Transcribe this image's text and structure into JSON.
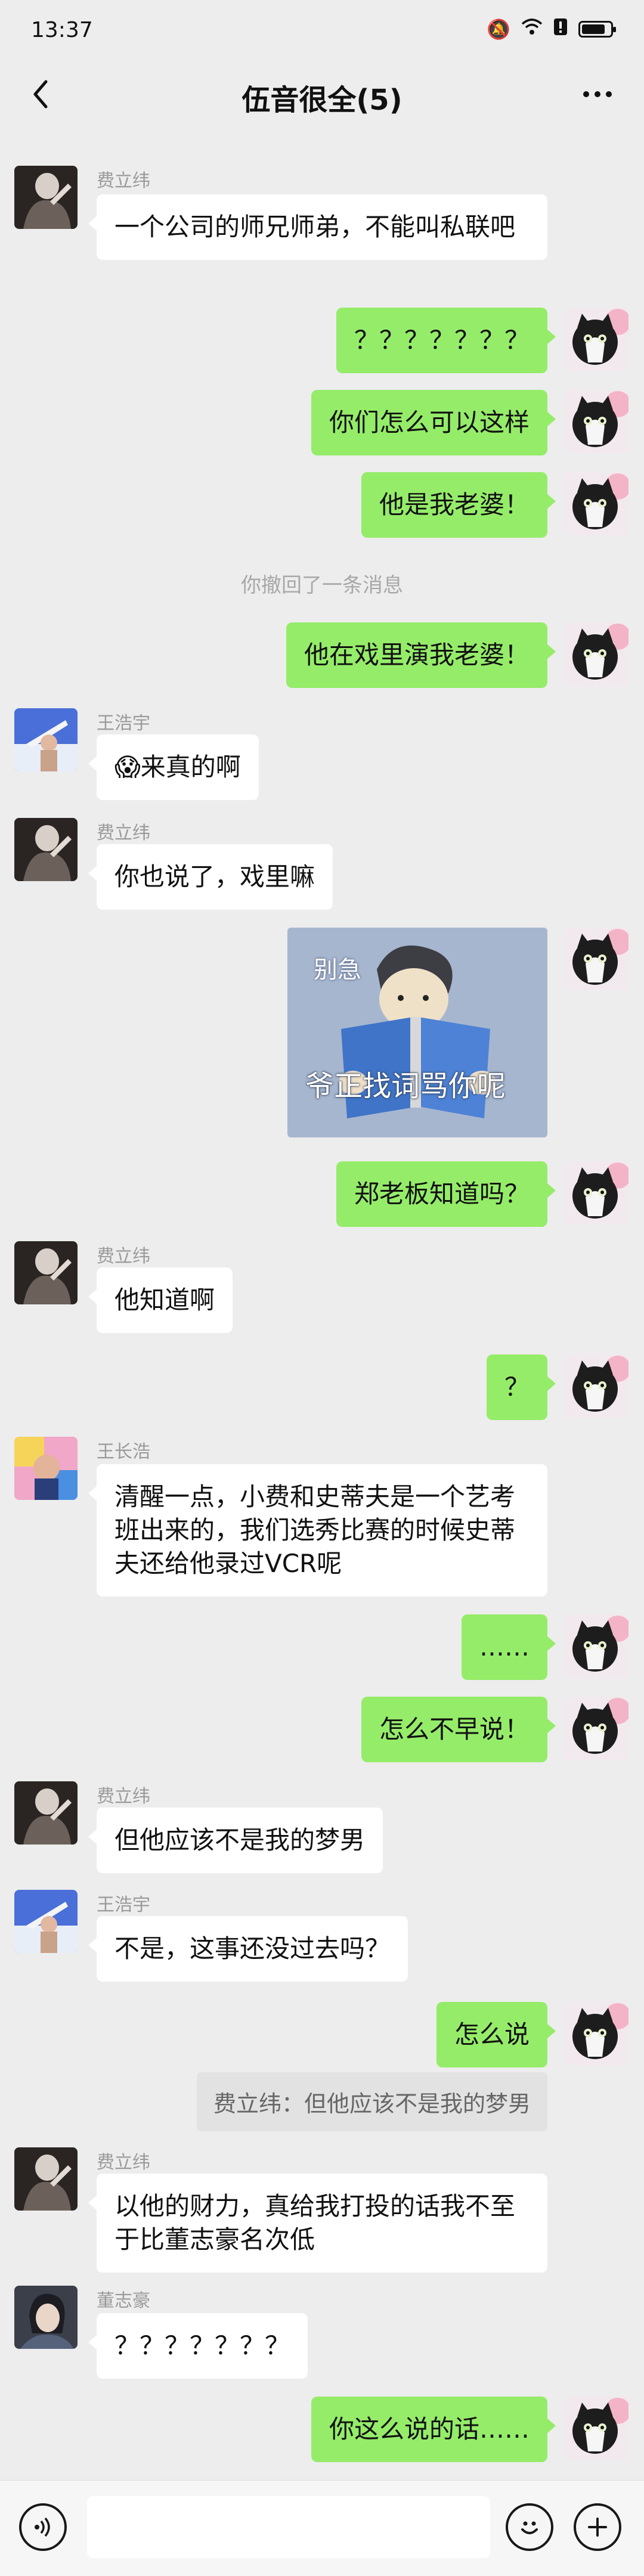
{
  "status": {
    "time": "13:37"
  },
  "header": {
    "title": "伍音很全(5)"
  },
  "colors": {
    "out_bubble": "#95ec69",
    "in_bubble": "#ffffff",
    "background": "#ededed"
  },
  "icons": {
    "back": "chevron-left-icon",
    "more": "more-dots-icon",
    "voice": "voice-icon",
    "emoji": "emoji-icon",
    "plus": "plus-icon"
  },
  "messages": [
    {
      "sender": "费立纬",
      "text": "一个公司的师兄师弟，不能叫私联吧"
    },
    {
      "text": "？？？？？？？"
    },
    {
      "text": "你们怎么可以这样"
    },
    {
      "text": "他是我老婆！"
    },
    {
      "system": "你撤回了一条消息"
    },
    {
      "text": "他在戏里演我老婆！"
    },
    {
      "sender": "王浩宇",
      "emoji": "😱",
      "text": "来真的啊"
    },
    {
      "sender": "费立纬",
      "text": "你也说了，戏里嘛"
    },
    {
      "sticker": {
        "caption_top": "别急",
        "caption_bottom": "爷正找词骂你呢"
      }
    },
    {
      "text": "郑老板知道吗？"
    },
    {
      "sender": "费立纬",
      "text": "他知道啊"
    },
    {
      "text": "？"
    },
    {
      "sender": "王长浩",
      "text": "清醒一点，小费和史蒂夫是一个艺考班出来的，我们选秀比赛的时候史蒂夫还给他录过VCR呢"
    },
    {
      "text": "……"
    },
    {
      "text": "怎么不早说！"
    },
    {
      "sender": "费立纬",
      "text": "但他应该不是我的梦男"
    },
    {
      "sender": "王浩宇",
      "text": "不是，这事还没过去吗？"
    },
    {
      "text": "怎么说",
      "quote": "费立纬：但他应该不是我的梦男"
    },
    {
      "sender": "费立纬",
      "text": "以他的财力，真给我打投的话我不至于比董志豪名次低"
    },
    {
      "sender": "董志豪",
      "text": "？？？？？？？"
    },
    {
      "text": "你这么说的话……"
    }
  ]
}
